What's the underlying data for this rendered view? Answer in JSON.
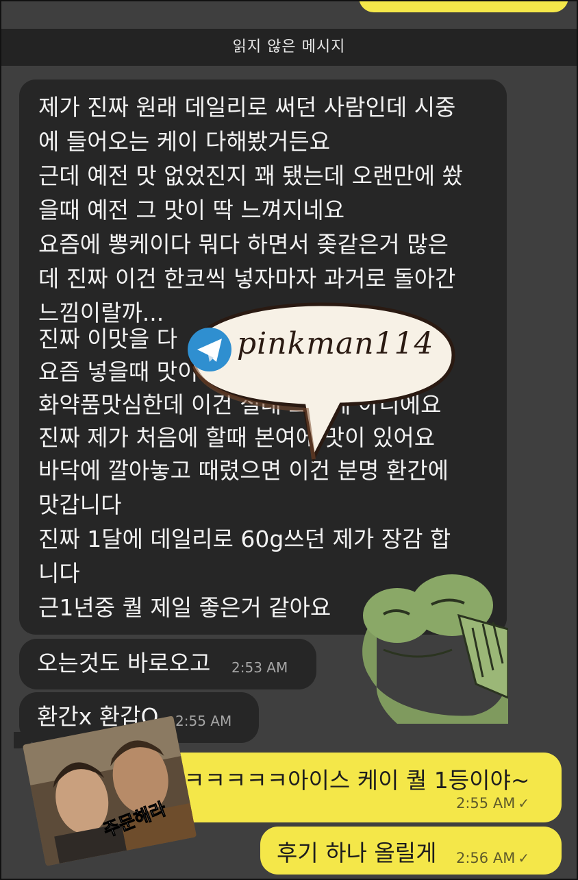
{
  "unread_divider": "읽지 않은 메시지",
  "incoming": {
    "main_lines": [
      "제가 진짜 원래 데일리로 써던 사람인데 시중",
      "에 들어오는 케이 다해봤거든요",
      "근데 예전 맛 없었진지 꽤 됐는데 오랜만에 쐈",
      "을때 예전 그 맛이 딱 느껴지네요",
      "요즘에 뽕케이다 뭐다 하면서 좆같은거 많은",
      "데 진짜 이건 한코씩 넣자마자 과거로 돌아간",
      "느낌이랄까...",
      "진짜 이맛을 다",
      "요즘 넣을때 맛이",
      "화약품맛심한데 이건 절대 그런게 아니에요",
      "진짜 제가 처음에 할때 본여에 맛이 있어요",
      "바닥에 깔아놓고 때렸으면 이건 분명 환간에",
      "맛갑니다",
      "진짜 1달에 데일리로 60g쓰던 제가 장감 합",
      "니다",
      "근1년중 퀄 제일 좋은거 같아요"
    ],
    "msg2": "오는것도 바로오고",
    "msg2_time": "2:53 AM",
    "msg3": "환간x 환갑O",
    "msg3_time": "2:55 AM"
  },
  "outgoing": {
    "msg1": "ㅋㅋㅋㅋㅋㅋ아이스 케이 퀄 1등이야~",
    "msg1_time": "2:55 AM",
    "msg2": "후기 하나 올릴게",
    "msg2_time": "2:56 AM",
    "read_mark": "✓"
  },
  "stickers": {
    "frog_icon": "frog-sticker-icon",
    "meme_caption": "주문해라"
  },
  "watermark": {
    "text": "pinkman114",
    "icon": "telegram-icon"
  },
  "colors": {
    "background": "#3f3f3f",
    "incoming_bubble": "#262626",
    "outgoing_bubble": "#f4e749",
    "divider": "#232323"
  }
}
